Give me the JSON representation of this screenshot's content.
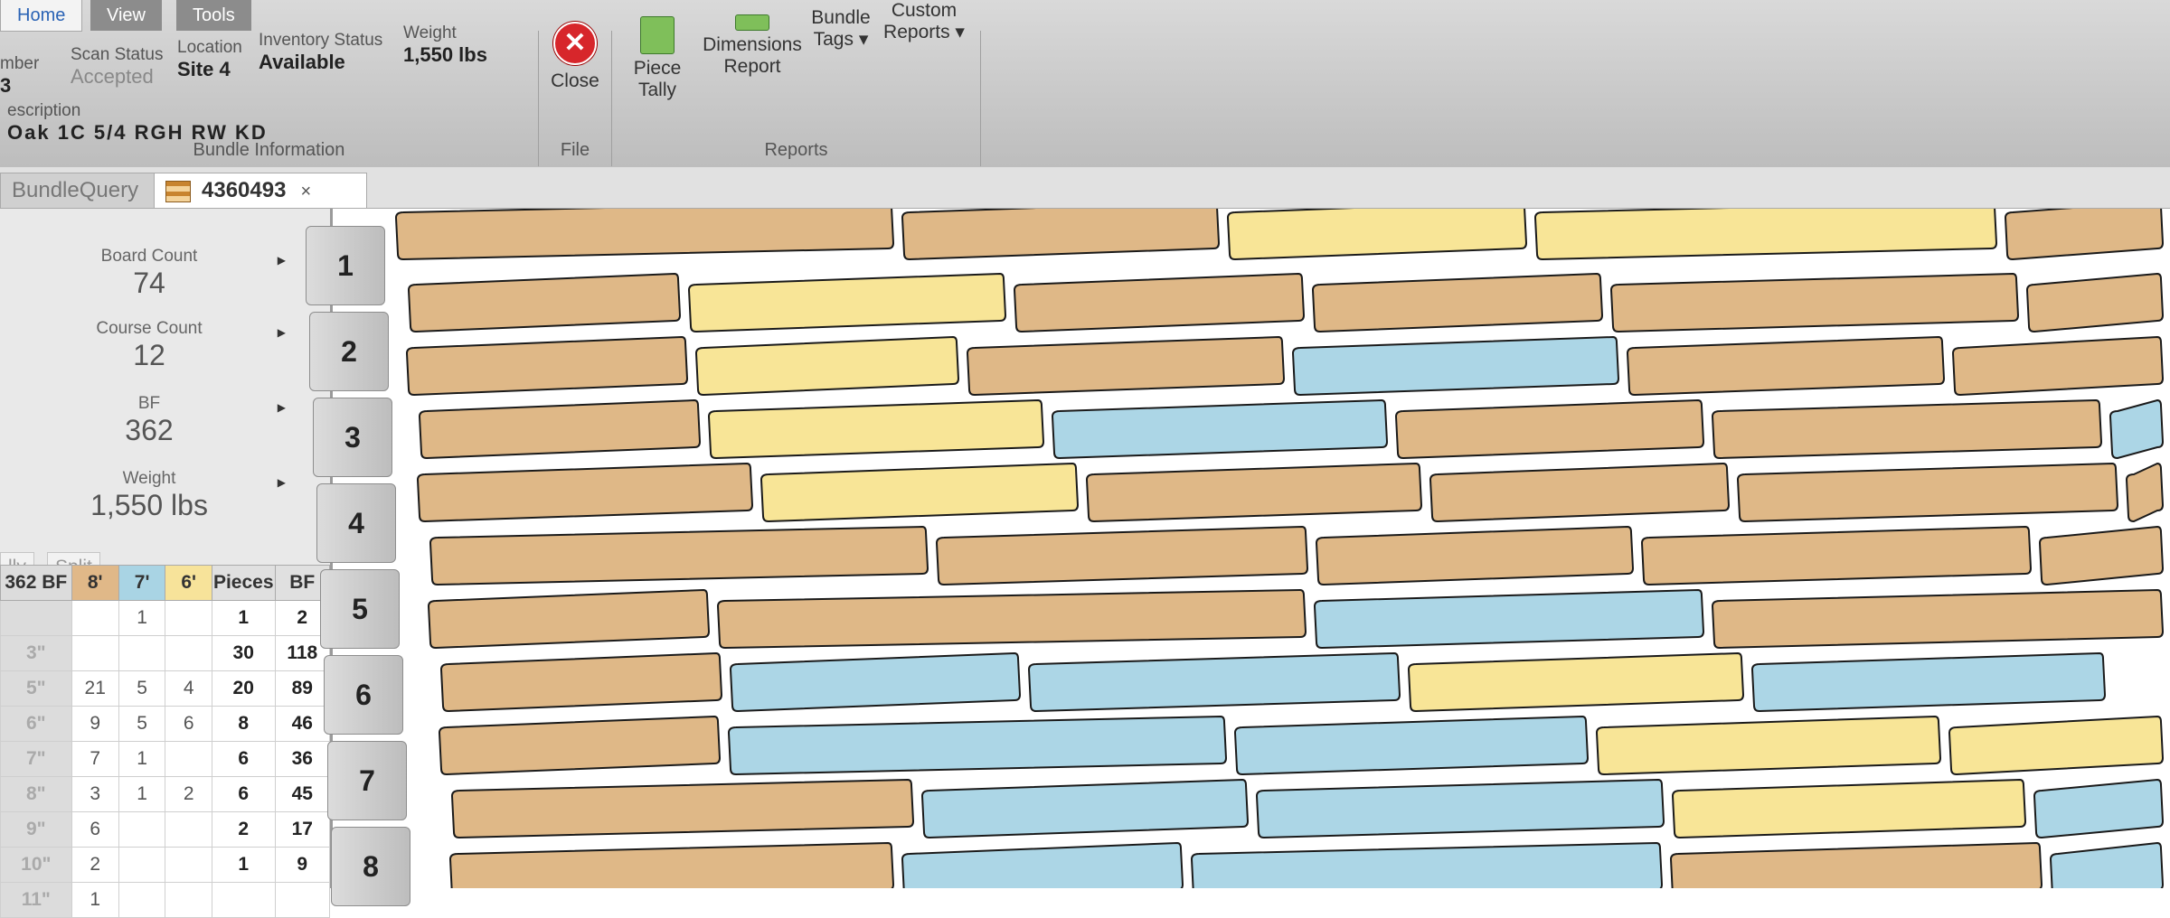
{
  "ribbon": {
    "tabs": [
      "Home",
      "View",
      "Tools"
    ],
    "bundle_info": {
      "label": "Bundle Information",
      "number_label": "mber",
      "number_value": "3",
      "scan_status_label": "Scan Status",
      "scan_status_value": "Accepted",
      "location_label": "Location",
      "location_value": "Site 4",
      "inventory_label": "Inventory Status",
      "inventory_value": "Available",
      "weight_label": "Weight",
      "weight_value": "1,550 lbs",
      "description_label": "escription",
      "description_value": "Oak 1C 5/4 RGH RW KD"
    },
    "file": {
      "label": "File",
      "close_label": "Close"
    },
    "reports": {
      "label": "Reports",
      "piece_tally": [
        "Piece",
        "Tally"
      ],
      "dimensions": [
        "Dimensions",
        "Report"
      ],
      "bundle_tags": [
        "Bundle",
        "Tags ▾"
      ],
      "custom": [
        "Custom",
        "Reports ▾"
      ]
    }
  },
  "doc_tabs": {
    "query": "BundleQuery",
    "active": "4360493",
    "close": "×"
  },
  "sidebar": {
    "stats": [
      {
        "label": "Board Count",
        "value": "74"
      },
      {
        "label": "Course Count",
        "value": "12"
      },
      {
        "label": "BF",
        "value": "362"
      },
      {
        "label": "Weight",
        "value": "1,550 lbs"
      }
    ],
    "subtabs": [
      "lly",
      "Split"
    ],
    "tally": {
      "headers": [
        "362 BF",
        "8'",
        "7'",
        "6'",
        "Pieces",
        "BF"
      ],
      "header_colors": [
        "#dcdcdc",
        "#e0b888",
        "#a9d4e4",
        "#f7e39a",
        "#e0e0e0",
        "#e0e0e0"
      ],
      "rows": [
        [
          "",
          "",
          "1",
          "",
          "1",
          "2"
        ],
        [
          "3\"",
          "",
          "",
          "",
          "30",
          "118"
        ],
        [
          "5\"",
          "21",
          "5",
          "4",
          "20",
          "89"
        ],
        [
          "6\"",
          "9",
          "5",
          "6",
          "8",
          "46"
        ],
        [
          "7\"",
          "7",
          "1",
          "",
          "6",
          "36"
        ],
        [
          "8\"",
          "3",
          "1",
          "2",
          "6",
          "45"
        ],
        [
          "9\"",
          "6",
          "",
          "",
          "2",
          "17"
        ],
        [
          "10\"",
          "2",
          "",
          "",
          "1",
          "9"
        ],
        [
          "11\"",
          "1",
          "",
          "",
          "",
          ""
        ]
      ]
    }
  },
  "courses": [
    "1",
    "2",
    "3",
    "4",
    "5",
    "6",
    "7",
    "8"
  ],
  "colors": {
    "oak8": "#dfb887",
    "oak7": "#acd6e6",
    "oak6": "#f8e597",
    "stroke": "#1a1a1a"
  }
}
